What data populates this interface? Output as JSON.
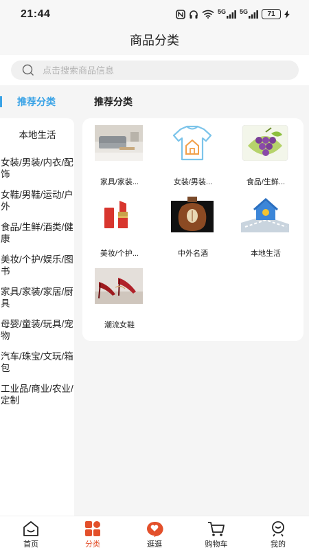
{
  "status": {
    "time": "21:44",
    "battery": "71",
    "net1": "5G",
    "net2": "5G"
  },
  "header": {
    "title": "商品分类"
  },
  "search": {
    "placeholder": "点击搜索商品信息"
  },
  "sidebar": {
    "active": "推荐分类",
    "items": [
      {
        "label": "本地生活"
      },
      {
        "label": "女装/男装/内衣/配饰"
      },
      {
        "label": "女鞋/男鞋/运动/户外"
      },
      {
        "label": "食品/生鲜/酒类/健康"
      },
      {
        "label": "美妆/个护/娱乐/图书"
      },
      {
        "label": "家具/家装/家居/厨具"
      },
      {
        "label": "母婴/童装/玩具/宠物"
      },
      {
        "label": "汽车/珠宝/文玩/箱包"
      },
      {
        "label": "工业品/商业/农业/定制"
      }
    ]
  },
  "main": {
    "section_title": "推荐分类",
    "items": [
      {
        "label": "家具/家装...",
        "icon": "sofa-image"
      },
      {
        "label": "女装/男装...",
        "icon": "tshirt-icon"
      },
      {
        "label": "食品/生鲜...",
        "icon": "grapes-image"
      },
      {
        "label": "美妆/个护...",
        "icon": "lipstick-image"
      },
      {
        "label": "中外名酒",
        "icon": "liquor-jar-image"
      },
      {
        "label": "本地生活",
        "icon": "house-map-icon"
      },
      {
        "label": "潮流女鞋",
        "icon": "high-heels-image"
      }
    ]
  },
  "tabbar": {
    "items": [
      {
        "label": "首页",
        "icon": "home-icon"
      },
      {
        "label": "分类",
        "icon": "category-icon"
      },
      {
        "label": "逛逛",
        "icon": "heart-chat-icon"
      },
      {
        "label": "购物车",
        "icon": "cart-icon"
      },
      {
        "label": "我的",
        "icon": "profile-icon"
      }
    ],
    "active_index": 1
  },
  "colors": {
    "accent": "#3aa3e6",
    "tab_active": "#e3502b"
  }
}
